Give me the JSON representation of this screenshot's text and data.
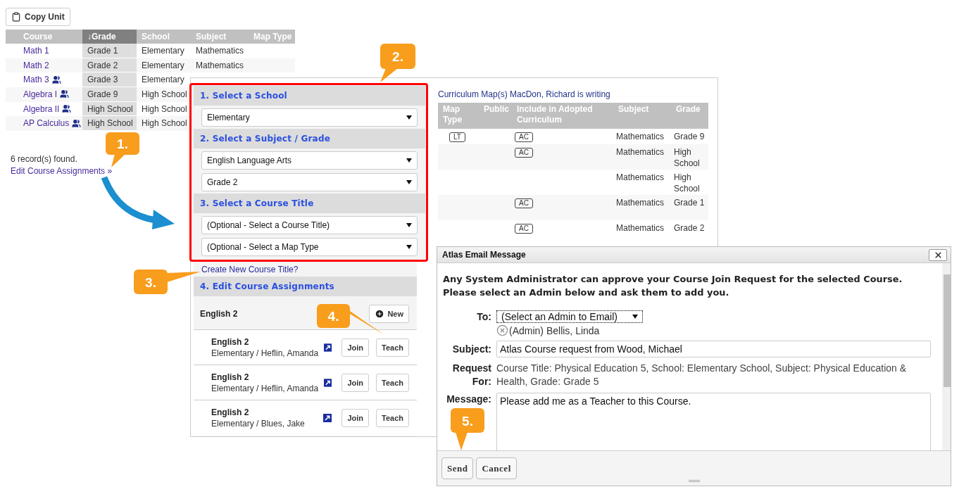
{
  "toolbar": {
    "copy_button": "Copy Unit"
  },
  "courses_table": {
    "columns": [
      {
        "label": "Course",
        "sorted": false
      },
      {
        "label": "↓Grade",
        "sorted": true
      },
      {
        "label": "School",
        "sorted": false
      },
      {
        "label": "Subject",
        "sorted": false
      },
      {
        "label": "Map Type",
        "sorted": false
      }
    ],
    "rows": [
      {
        "course": "Math 1",
        "shared": false,
        "grade": "Grade 1",
        "school": "Elementary",
        "subject": "Mathematics"
      },
      {
        "course": "Math 2",
        "shared": false,
        "grade": "Grade 2",
        "school": "Elementary",
        "subject": "Mathematics"
      },
      {
        "course": "Math 3",
        "shared": true,
        "grade": "Grade 3",
        "school": "Elementary"
      },
      {
        "course": "Algebra I",
        "shared": true,
        "grade": "Grade 9",
        "school": "High School"
      },
      {
        "course": "Algebra II",
        "shared": true,
        "grade": "High School",
        "school": "High School"
      },
      {
        "course": "AP Calculus",
        "shared": true,
        "grade": "High School",
        "school": "High School"
      }
    ]
  },
  "records_found": "6 record(s) found.",
  "edit_link": "Edit Course Assignments »",
  "assignment_panel": {
    "sections": [
      {
        "title": "1. Select a School",
        "selects": [
          "Elementary"
        ]
      },
      {
        "title": "2. Select a Subject / Grade",
        "selects": [
          "English Language Arts",
          "Grade 2"
        ]
      },
      {
        "title": "3. Select a Course Title",
        "selects": [
          "(Optional - Select a Course Title)",
          "(Optional - Select a Map Type"
        ]
      }
    ],
    "create_link": "Create New Course Title?",
    "edit_section": {
      "title": "4. Edit Course Assignments",
      "group_title": "English 2",
      "new_button": "New",
      "items": [
        {
          "title": "English 2",
          "detail": "Elementary / Heflin, Amanda",
          "join": "Join",
          "teach": "Teach"
        },
        {
          "title": "English 2",
          "detail": "Elementary / Heflin, Amanda",
          "join": "Join",
          "teach": "Teach"
        },
        {
          "title": "English 2",
          "detail": "Elementary / Blues, Jake",
          "join": "Join",
          "teach": "Teach"
        }
      ]
    }
  },
  "curriculum_map": {
    "title": "Curriculum Map(s) MacDon, Richard is writing",
    "columns": [
      "Map Type",
      "Public",
      "Include in Adopted Curriculum",
      "Subject",
      "Grade"
    ],
    "rows": [
      {
        "map_type": "LT",
        "adopted": "AC",
        "subject": "Mathematics",
        "grade": "Grade 9"
      },
      {
        "adopted": "AC",
        "subject": "Mathematics",
        "grade": "High School"
      },
      {
        "subject": "Mathematics",
        "grade": "High School"
      },
      {
        "adopted": "AC",
        "subject": "Mathematics",
        "grade": "Grade 1"
      },
      {
        "adopted": "AC",
        "subject": "Mathematics",
        "grade": "Grade 2"
      }
    ]
  },
  "dialog": {
    "title": "Atlas Email Message",
    "intro": "Any System Administrator can approve your Course Join Request for the selected Course. Please select an Admin below and ask them to add you.",
    "to_label": "To:",
    "to_select": "(Select an Admin to Email)",
    "recipient": "(Admin) Bellis, Linda",
    "subject_label": "Subject:",
    "subject_value": "Atlas Course request from Wood, Michael",
    "request_label": "Request For:",
    "request_text": "Course Title: Physical Education 5, School: Elementary School, Subject: Physical Education & Health, Grade: Grade 5",
    "message_label": "Message:",
    "message_value": "Please add me as a Teacher to this Course.",
    "buttons": [
      "Send",
      "Cancel"
    ]
  },
  "callouts": [
    {
      "label": "1."
    },
    {
      "label": "2."
    },
    {
      "label": "3."
    },
    {
      "label": "4."
    },
    {
      "label": "5."
    }
  ]
}
